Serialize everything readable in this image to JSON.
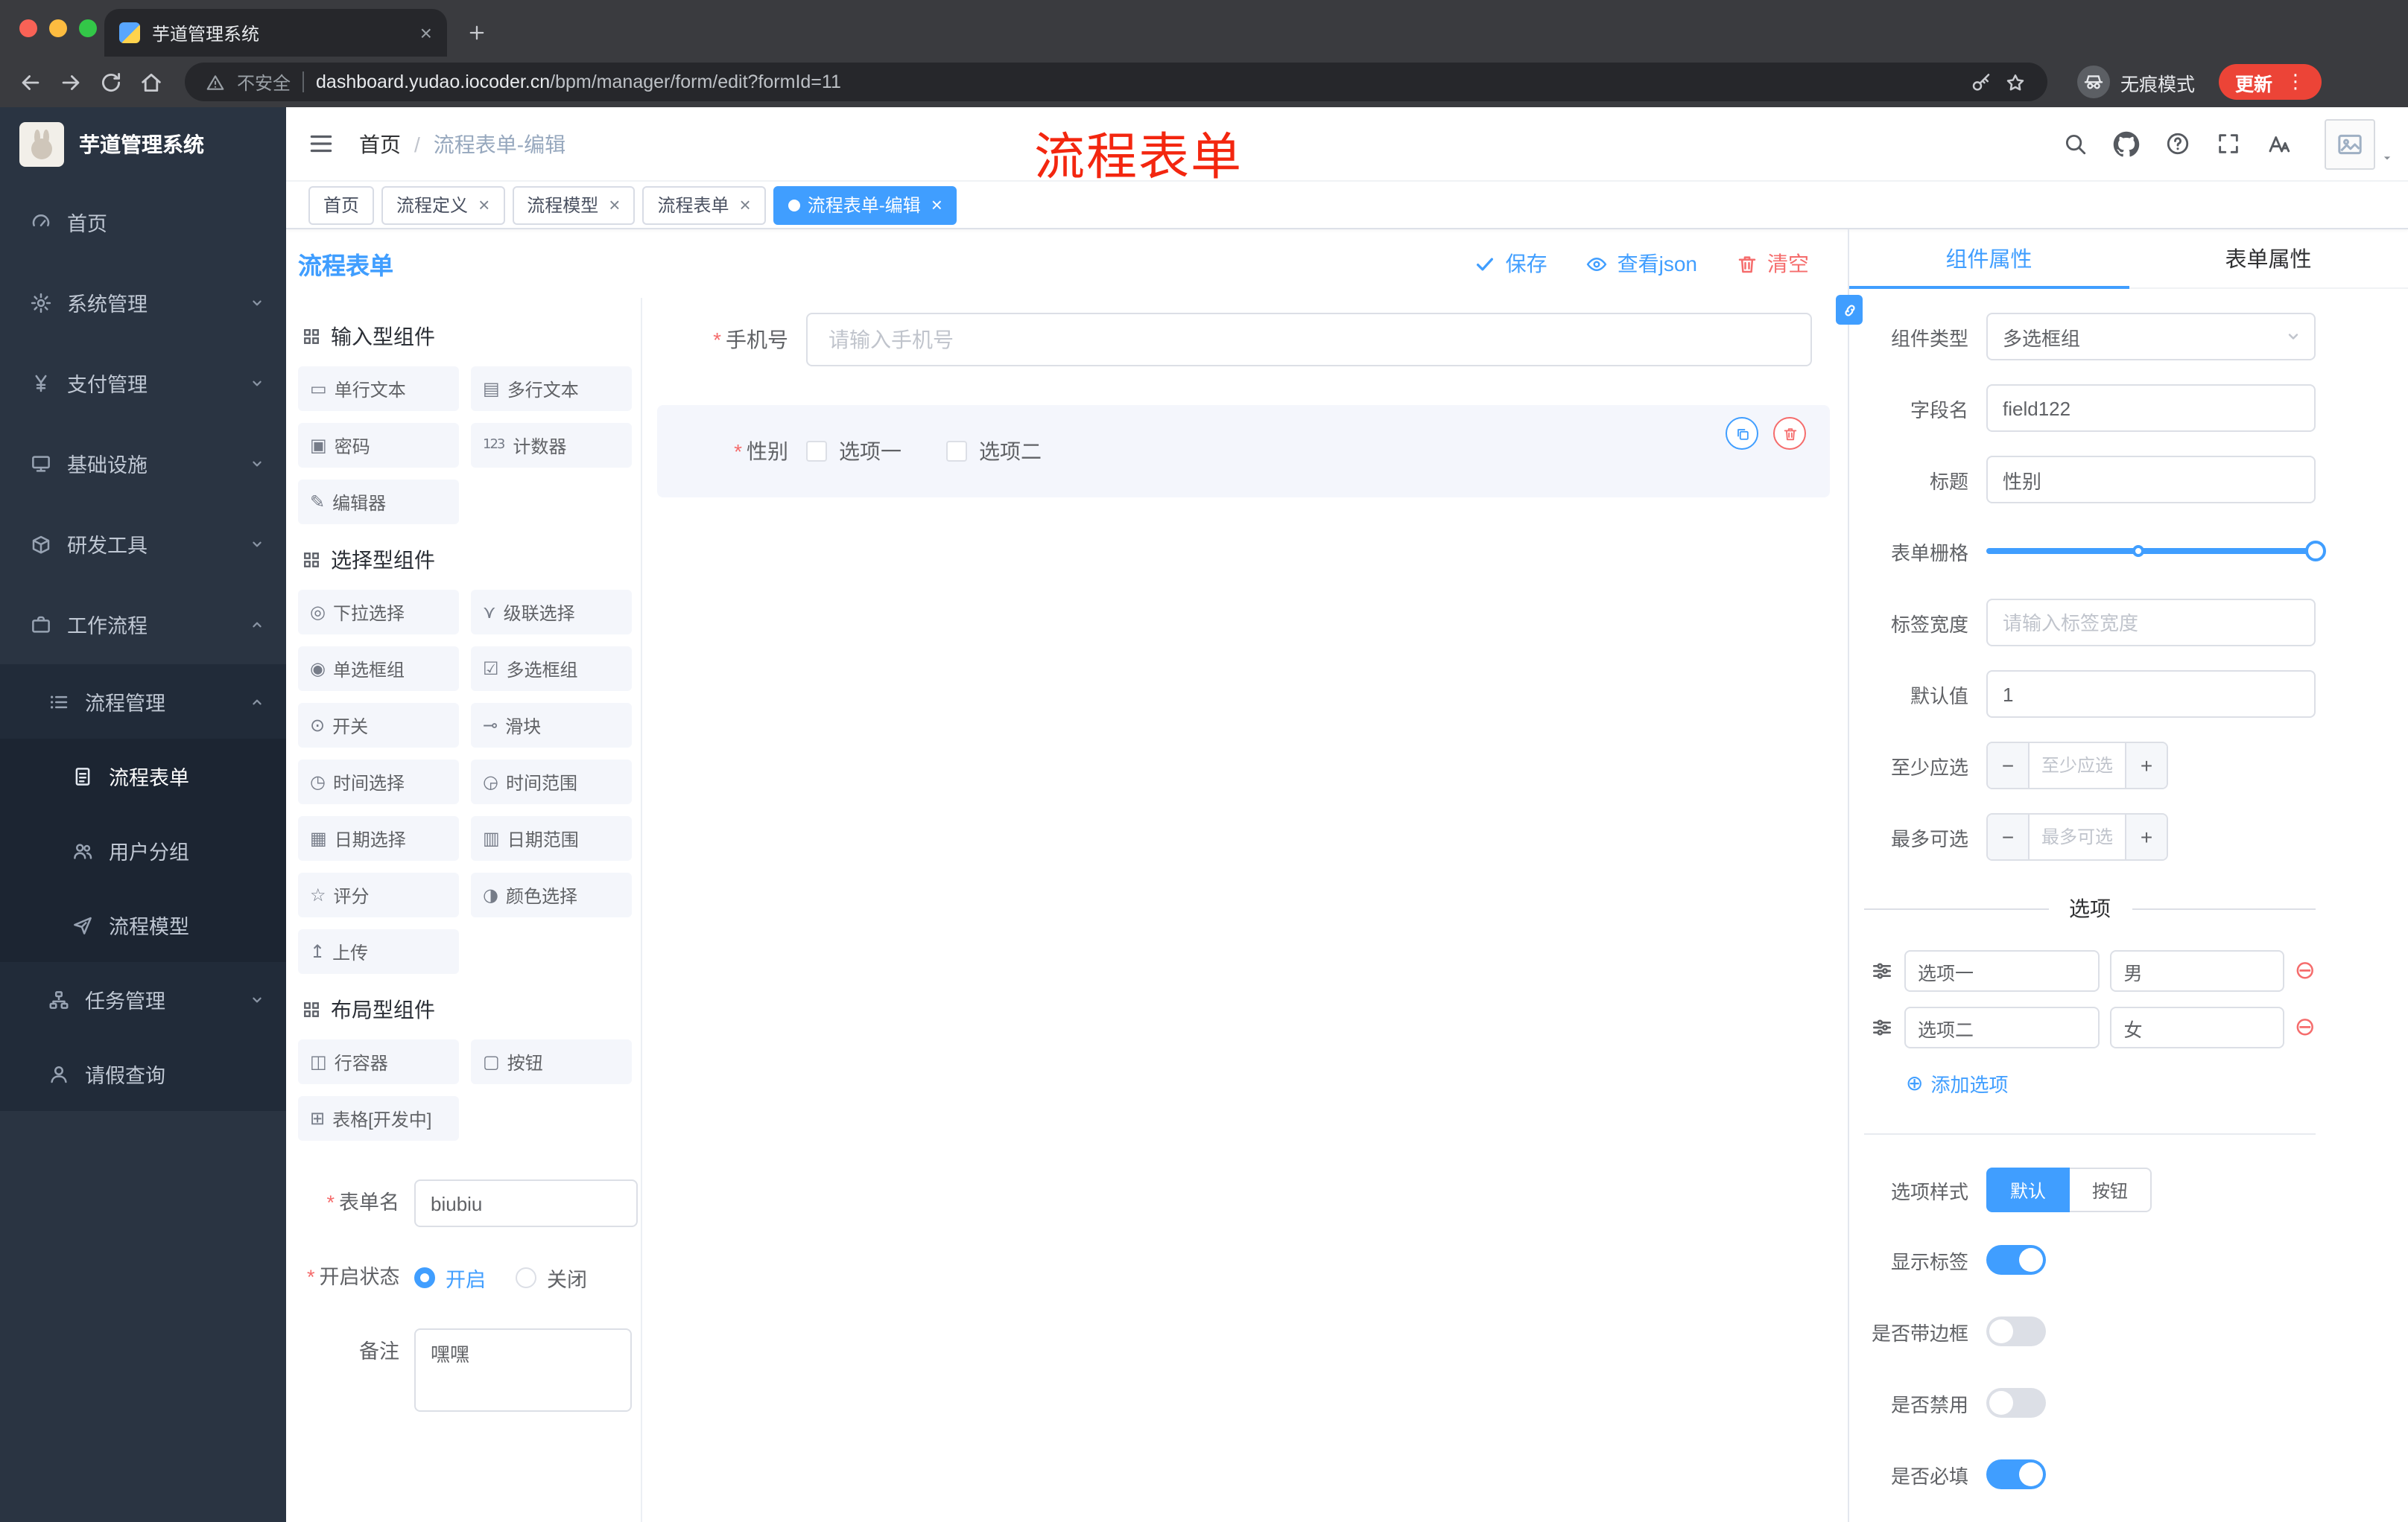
{
  "browser": {
    "tab_title": "芋道管理系统",
    "security": "不安全",
    "url_host": "dashboard.yudao.iocoder.cn",
    "url_path": "/bpm/manager/form/edit?formId=11",
    "incognito": "无痕模式",
    "update": "更新"
  },
  "sidebar": {
    "title": "芋道管理系统",
    "items": [
      {
        "label": "首页"
      },
      {
        "label": "系统管理"
      },
      {
        "label": "支付管理"
      },
      {
        "label": "基础设施"
      },
      {
        "label": "研发工具"
      },
      {
        "label": "工作流程"
      },
      {
        "label": "流程管理"
      },
      {
        "label": "流程表单"
      },
      {
        "label": "用户分组"
      },
      {
        "label": "流程模型"
      },
      {
        "label": "任务管理"
      },
      {
        "label": "请假查询"
      }
    ]
  },
  "header": {
    "breadcrumb_home": "首页",
    "breadcrumb_sep": "/",
    "breadcrumb_current": "流程表单-编辑",
    "annotation": "流程表单"
  },
  "tags": [
    {
      "label": "首页"
    },
    {
      "label": "流程定义"
    },
    {
      "label": "流程模型"
    },
    {
      "label": "流程表单"
    },
    {
      "label": "流程表单-编辑"
    }
  ],
  "designer": {
    "title": "流程表单",
    "save": "保存",
    "view_json": "查看json",
    "clear": "清空",
    "sections": [
      {
        "title": "输入型组件",
        "items": [
          {
            "label": "单行文本",
            "glyph": "▭"
          },
          {
            "label": "多行文本",
            "glyph": "▤"
          },
          {
            "label": "密码",
            "glyph": "▣"
          },
          {
            "label": "计数器",
            "glyph": "123"
          },
          {
            "label": "编辑器",
            "glyph": "✎"
          }
        ]
      },
      {
        "title": "选择型组件",
        "items": [
          {
            "label": "下拉选择",
            "glyph": "◎"
          },
          {
            "label": "级联选择",
            "glyph": "⋎"
          },
          {
            "label": "单选框组",
            "glyph": "◉"
          },
          {
            "label": "多选框组",
            "glyph": "☑"
          },
          {
            "label": "开关",
            "glyph": "⊙"
          },
          {
            "label": "滑块",
            "glyph": "⊸"
          },
          {
            "label": "时间选择",
            "glyph": "◷"
          },
          {
            "label": "时间范围",
            "glyph": "◶"
          },
          {
            "label": "日期选择",
            "glyph": "▦"
          },
          {
            "label": "日期范围",
            "glyph": "▥"
          },
          {
            "label": "评分",
            "glyph": "☆"
          },
          {
            "label": "颜色选择",
            "glyph": "◑"
          },
          {
            "label": "上传",
            "glyph": "↥"
          }
        ]
      },
      {
        "title": "布局型组件",
        "items": [
          {
            "label": "行容器",
            "glyph": "◫"
          },
          {
            "label": "按钮",
            "glyph": "▢"
          },
          {
            "label": "表格[开发中]",
            "glyph": "⊞"
          }
        ]
      }
    ],
    "meta": {
      "form_name_label": "表单名",
      "form_name_value": "biubiu",
      "status_label": "开启状态",
      "status_on": "开启",
      "status_off": "关闭",
      "remark_label": "备注",
      "remark_value": "嘿嘿"
    },
    "canvas": {
      "phone_label": "手机号",
      "phone_placeholder": "请输入手机号",
      "gender_label": "性别",
      "gender_option1": "选项一",
      "gender_option2": "选项二"
    }
  },
  "props": {
    "tab_component": "组件属性",
    "tab_form": "表单属性",
    "component_type_label": "组件类型",
    "component_type_value": "多选框组",
    "field_name_label": "字段名",
    "field_name_value": "field122",
    "title_label": "标题",
    "title_value": "性别",
    "grid_label": "表单栅格",
    "label_width_label": "标签宽度",
    "label_width_placeholder": "请输入标签宽度",
    "default_label": "默认值",
    "default_value": "1",
    "min_label": "至少应选",
    "min_placeholder": "至少应选",
    "max_label": "最多可选",
    "max_placeholder": "最多可选",
    "options_title": "选项",
    "options": [
      {
        "label": "选项一",
        "value": "男"
      },
      {
        "label": "选项二",
        "value": "女"
      }
    ],
    "add_option": "添加选项",
    "style_label": "选项样式",
    "style_default": "默认",
    "style_button": "按钮",
    "switches": [
      {
        "label": "显示标签"
      },
      {
        "label": "是否带边框"
      },
      {
        "label": "是否禁用"
      },
      {
        "label": "是否必填"
      }
    ]
  },
  "colors": {
    "primary": "#409eff",
    "danger": "#f56c6c",
    "annotation_red": "#f3260f",
    "sidebar_bg": "#2a3442",
    "update_pill": "#ec4437"
  }
}
